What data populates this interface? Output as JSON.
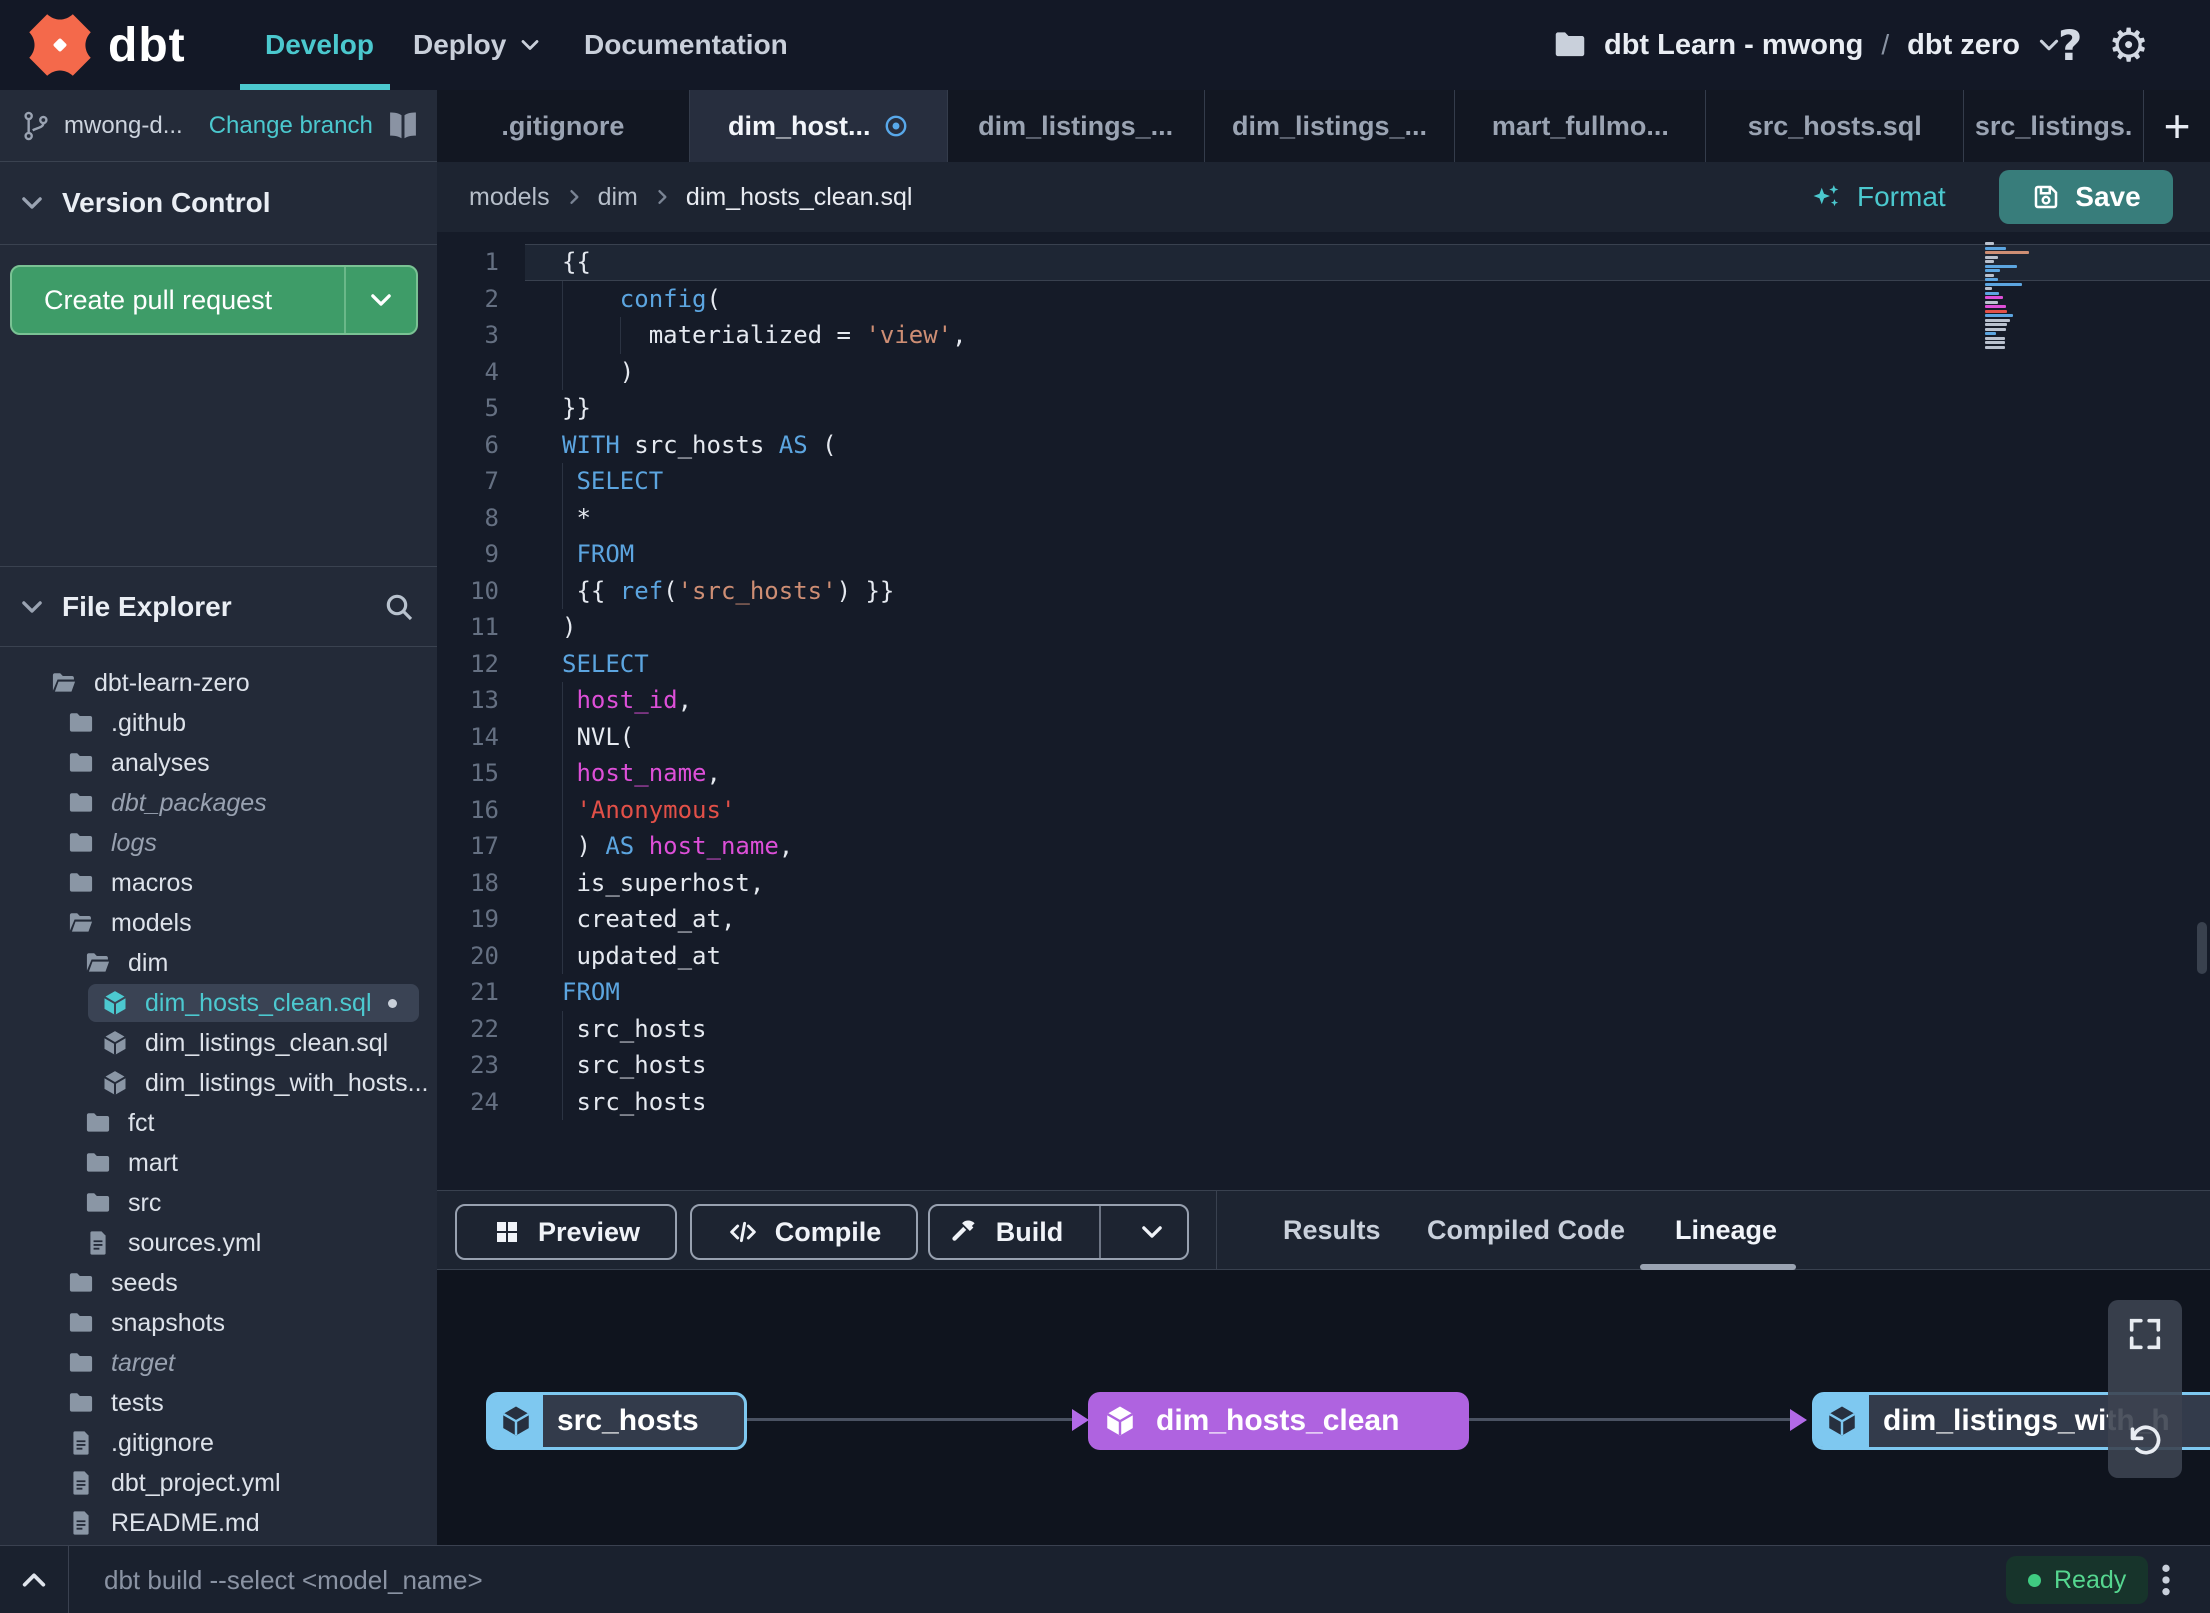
{
  "navbar": {
    "brand": "dbt",
    "nav": [
      {
        "label": "Develop",
        "active": true
      },
      {
        "label": "Deploy",
        "dropdown": true
      },
      {
        "label": "Documentation"
      }
    ],
    "project": "dbt Learn - mwong",
    "path_separator": "/",
    "environment": "dbt zero",
    "help_glyph": "?",
    "gear_glyph": "⚙"
  },
  "branch_bar": {
    "branch_name": "mwong-d...",
    "change_branch_label": "Change branch"
  },
  "version_control": {
    "title": "Version Control",
    "create_pr_label": "Create pull request"
  },
  "file_explorer": {
    "title": "File Explorer",
    "tree": [
      {
        "name": "dbt-learn-zero",
        "icon": "folder-open",
        "level": 0
      },
      {
        "name": ".github",
        "icon": "folder",
        "level": 1
      },
      {
        "name": "analyses",
        "icon": "folder",
        "level": 1
      },
      {
        "name": "dbt_packages",
        "icon": "folder",
        "level": 1,
        "italic": true
      },
      {
        "name": "logs",
        "icon": "folder",
        "level": 1,
        "italic": true
      },
      {
        "name": "macros",
        "icon": "folder",
        "level": 1
      },
      {
        "name": "models",
        "icon": "folder-open",
        "level": 1
      },
      {
        "name": "dim",
        "icon": "folder-open",
        "level": 2
      },
      {
        "name": "dim_hosts_clean.sql",
        "icon": "cube",
        "level": 3,
        "selected": true,
        "modified": true
      },
      {
        "name": "dim_listings_clean.sql",
        "icon": "cube",
        "level": 3
      },
      {
        "name": "dim_listings_with_hosts...",
        "icon": "cube",
        "level": 3
      },
      {
        "name": "fct",
        "icon": "folder",
        "level": 2
      },
      {
        "name": "mart",
        "icon": "folder",
        "level": 2
      },
      {
        "name": "src",
        "icon": "folder",
        "level": 2
      },
      {
        "name": "sources.yml",
        "icon": "file",
        "level": 2
      },
      {
        "name": "seeds",
        "icon": "folder",
        "level": 1
      },
      {
        "name": "snapshots",
        "icon": "folder",
        "level": 1
      },
      {
        "name": "target",
        "icon": "folder",
        "level": 1,
        "italic": true
      },
      {
        "name": "tests",
        "icon": "folder",
        "level": 1
      },
      {
        "name": ".gitignore",
        "icon": "file",
        "level": 1
      },
      {
        "name": "dbt_project.yml",
        "icon": "file",
        "level": 1
      },
      {
        "name": "README.md",
        "icon": "file",
        "level": 1
      }
    ]
  },
  "tabs": [
    {
      "label": ".gitignore"
    },
    {
      "label": "dim_host...",
      "active": true,
      "modified": true
    },
    {
      "label": "dim_listings_..."
    },
    {
      "label": "dim_listings_..."
    },
    {
      "label": "mart_fullmo..."
    },
    {
      "label": "src_hosts.sql"
    },
    {
      "label": "src_listings."
    }
  ],
  "new_tab_glyph": "+",
  "breadcrumb": {
    "items": [
      "models",
      "dim",
      "dim_hosts_clean.sql"
    ]
  },
  "editor_actions": {
    "format_label": "Format",
    "save_label": "Save"
  },
  "editor": {
    "lines": [
      {
        "num": 1,
        "current": true,
        "tokens": [
          [
            "{{",
            "p"
          ]
        ],
        "guides": []
      },
      {
        "num": 2,
        "tokens": [
          [
            "    ",
            "p"
          ],
          [
            "config",
            "f"
          ],
          [
            "(",
            "p"
          ]
        ],
        "guides": [
          0
        ]
      },
      {
        "num": 3,
        "tokens": [
          [
            "      materialized = ",
            "p"
          ],
          [
            "'view'",
            "s"
          ],
          [
            ",",
            "p"
          ]
        ],
        "guides": [
          0,
          4
        ]
      },
      {
        "num": 4,
        "tokens": [
          [
            "    )",
            "p"
          ]
        ],
        "guides": [
          0
        ]
      },
      {
        "num": 5,
        "tokens": [
          [
            "}}",
            "p"
          ]
        ],
        "guides": []
      },
      {
        "num": 6,
        "tokens": [
          [
            "WITH",
            "k"
          ],
          [
            " src_hosts ",
            "p"
          ],
          [
            "AS",
            "k"
          ],
          [
            " (",
            "p"
          ]
        ],
        "guides": []
      },
      {
        "num": 7,
        "tokens": [
          [
            " ",
            "p"
          ],
          [
            "SELECT",
            "k"
          ]
        ],
        "guides": [
          0
        ]
      },
      {
        "num": 8,
        "tokens": [
          [
            " *",
            "p"
          ]
        ],
        "guides": [
          0
        ]
      },
      {
        "num": 9,
        "tokens": [
          [
            " ",
            "p"
          ],
          [
            "FROM",
            "k"
          ]
        ],
        "guides": [
          0
        ]
      },
      {
        "num": 10,
        "tokens": [
          [
            " {{ ",
            "p"
          ],
          [
            "ref",
            "f"
          ],
          [
            "(",
            "p"
          ],
          [
            "'src_hosts'",
            "s"
          ],
          [
            ") }}",
            "p"
          ]
        ],
        "guides": [
          0
        ]
      },
      {
        "num": 11,
        "tokens": [
          [
            ")",
            "p"
          ]
        ],
        "guides": []
      },
      {
        "num": 12,
        "tokens": [
          [
            "SELECT",
            "k"
          ]
        ],
        "guides": []
      },
      {
        "num": 13,
        "tokens": [
          [
            " ",
            "p"
          ],
          [
            "host_id",
            "m"
          ],
          [
            ",",
            "p"
          ]
        ],
        "guides": [
          0
        ]
      },
      {
        "num": 14,
        "tokens": [
          [
            " NVL(",
            "p"
          ]
        ],
        "guides": [
          0
        ]
      },
      {
        "num": 15,
        "tokens": [
          [
            " ",
            "p"
          ],
          [
            "host_name",
            "m"
          ],
          [
            ",",
            "p"
          ]
        ],
        "guides": [
          0
        ]
      },
      {
        "num": 16,
        "tokens": [
          [
            " ",
            "p"
          ],
          [
            "'Anonymous'",
            "r"
          ]
        ],
        "guides": [
          0
        ]
      },
      {
        "num": 17,
        "tokens": [
          [
            " ) ",
            "p"
          ],
          [
            "AS",
            "k"
          ],
          [
            " ",
            "p"
          ],
          [
            "host_name",
            "m"
          ],
          [
            ",",
            "p"
          ]
        ],
        "guides": [
          0
        ]
      },
      {
        "num": 18,
        "tokens": [
          [
            " is_superhost,",
            "p"
          ]
        ],
        "guides": [
          0
        ]
      },
      {
        "num": 19,
        "tokens": [
          [
            " created_at,",
            "p"
          ]
        ],
        "guides": [
          0
        ]
      },
      {
        "num": 20,
        "tokens": [
          [
            " updated_at",
            "p"
          ]
        ],
        "guides": [
          0
        ]
      },
      {
        "num": 21,
        "tokens": [
          [
            "FROM",
            "k"
          ]
        ],
        "guides": []
      },
      {
        "num": 22,
        "tokens": [
          [
            " src_hosts",
            "p"
          ]
        ],
        "guides": [
          0
        ]
      },
      {
        "num": 23,
        "tokens": [
          [
            " src_hosts",
            "p"
          ]
        ],
        "guides": [
          0
        ]
      },
      {
        "num": 24,
        "tokens": [
          [
            " src_hosts",
            "p"
          ]
        ],
        "guides": [
          0
        ]
      }
    ]
  },
  "bottom_toolbar": {
    "preview_label": "Preview",
    "compile_label": "Compile",
    "build_label": "Build",
    "tabs": [
      {
        "label": "Results"
      },
      {
        "label": "Compiled Code"
      },
      {
        "label": "Lineage",
        "active": true
      }
    ]
  },
  "lineage": {
    "nodes": [
      {
        "label": "src_hosts",
        "style": "blue"
      },
      {
        "label": "dim_hosts_clean",
        "style": "purple"
      },
      {
        "label": "dim_listings_with_h",
        "style": "blue"
      }
    ]
  },
  "statusbar": {
    "command": "dbt build --select <model_name>",
    "status_label": "Ready"
  },
  "colors": {
    "accent_teal": "#4BC8CE",
    "brand_orange": "#F4694B",
    "pr_green": "#3E9C68",
    "save_teal": "#387D7B",
    "node_blue": "#7EC8F0",
    "node_purple": "#AF63E0",
    "ready_green": "#55D68F",
    "tab_modified_blue": "#58A8EA",
    "code_keyword": "#5CA5E0",
    "code_string": "#CE8E74",
    "code_string_red": "#E25048",
    "code_field": "#DD4FD8"
  }
}
